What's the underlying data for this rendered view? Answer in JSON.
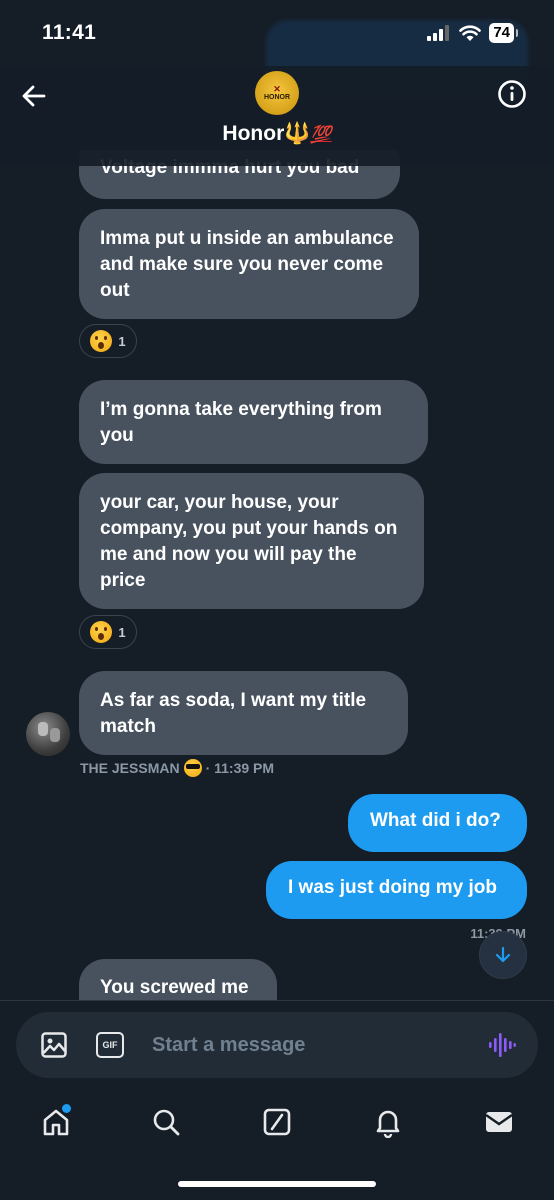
{
  "status_bar": {
    "time": "11:41",
    "battery": "74"
  },
  "header": {
    "avatar_text": "HONOR",
    "group_name": "Honor",
    "name_emoji": "🔱",
    "name_emoji_2": "💯"
  },
  "messages": {
    "m1": "Voltage immma hurt you bad",
    "m2": "Imma put u inside an ambulance and make sure you never come out",
    "m3": "I’m gonna take everything from you",
    "m4": "your car, your house, your company, you put your hands on me and now you will pay the price",
    "m5": "As far as soda, I want my title match",
    "m6": "What did i do?",
    "m7": "I was just doing my job",
    "m8": "You screwed me"
  },
  "reactions": {
    "r1_count": "1",
    "r2_count": "1"
  },
  "meta": {
    "sender": "THE JESSMAN",
    "sender_time": "· 11:39 PM",
    "my_time": "11:39 PM"
  },
  "composer": {
    "placeholder": "Start a message",
    "gif_label": "GIF"
  },
  "tabs": [
    "home-icon",
    "search-icon",
    "grok-icon",
    "notifications-icon",
    "messages-icon"
  ],
  "colors": {
    "my_bubble": "#1d9bf0",
    "their_bubble": "#48525f",
    "background": "#151d27",
    "accent_voice": "#8b5cf6"
  }
}
